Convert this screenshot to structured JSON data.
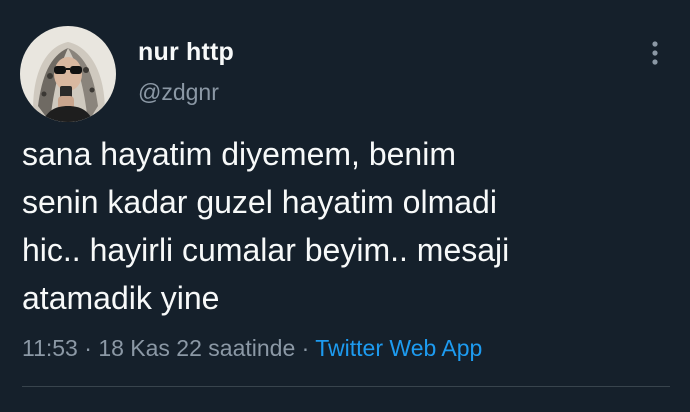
{
  "user": {
    "display_name": "nur http",
    "handle": "@zdgnr",
    "avatar_icon": "profile-photo"
  },
  "tweet": {
    "text": "sana hayatim diyemem, benim\nsenin kadar guzel hayatim olmadi\nhic.. hayirli cumalar beyim.. mesaji\natamadik yine",
    "time": "11:53",
    "separator": " · ",
    "date": "18 Kas 22 saatinde",
    "source": "Twitter Web App"
  },
  "icons": {
    "more": "more-vertical-icon"
  },
  "colors": {
    "background": "#15202b",
    "primary_text": "#f7f9f9",
    "secondary_text": "#8b98a5",
    "link": "#1d9bf0"
  }
}
